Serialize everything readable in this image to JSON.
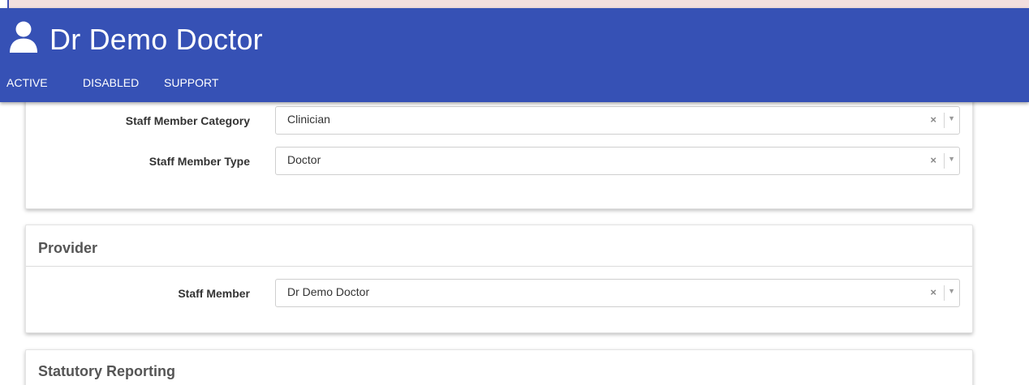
{
  "header": {
    "title": "Dr Demo Doctor",
    "icon": "user-icon",
    "color": "#3651b5"
  },
  "nav": {
    "tabs": [
      {
        "label": "ACTIVE"
      },
      {
        "label": "DISABLED"
      },
      {
        "label": "SUPPORT"
      }
    ]
  },
  "staff_card": {
    "fields": [
      {
        "label": "Staff Member Category",
        "value": "Clinician",
        "clear_glyph": "×",
        "caret_glyph": "▼"
      },
      {
        "label": "Staff Member Type",
        "value": "Doctor",
        "clear_glyph": "×",
        "caret_glyph": "▼"
      }
    ]
  },
  "provider_card": {
    "title": "Provider",
    "fields": [
      {
        "label": "Staff Member",
        "value": "Dr Demo Doctor",
        "clear_glyph": "×",
        "caret_glyph": "▼"
      }
    ]
  },
  "statutory_card": {
    "title": "Statutory Reporting"
  }
}
